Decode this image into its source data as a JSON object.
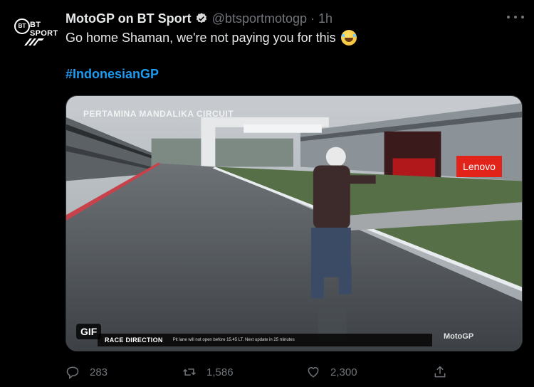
{
  "tweet": {
    "avatar_text": "BT SPORT",
    "avatar_logo_text": "BT",
    "author_name": "MotoGP on BT Sport",
    "handle": "@btsportmotogp",
    "separator": "·",
    "time": "1h",
    "text": "Go home Shaman, we're not paying you for this",
    "hashtag": "#IndonesianGP"
  },
  "media": {
    "type": "GIF",
    "gif_badge": "GIF",
    "circuit_label": "PERTAMINA MANDALIKA CIRCUIT",
    "sponsor_label": "Lenovo",
    "info_bar_title": "RACE DIRECTION",
    "info_bar_message": "Pit lane will not open before 15.45 LT. Next update in 25 minutes",
    "broadcast_logo": "MotoGP"
  },
  "actions": {
    "replies": "283",
    "retweets": "1,586",
    "likes": "2,300"
  },
  "colors": {
    "background": "#000000",
    "text": "#e7e9ea",
    "muted": "#71767b",
    "accent": "#1d9bf0"
  },
  "icons": [
    "verified-badge-icon",
    "more-options-icon",
    "reply-icon",
    "retweet-icon",
    "like-icon",
    "share-icon"
  ]
}
